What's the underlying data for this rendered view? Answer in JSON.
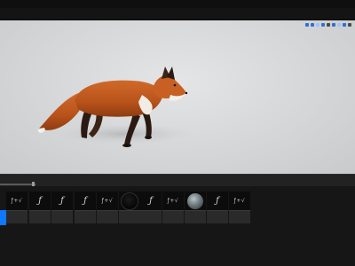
{
  "colors": {
    "accent": "#0e78ff",
    "viewport_bg": "#dcdddf",
    "panel_bg": "#161616"
  },
  "viewport": {
    "subject": "fox-model",
    "toolbar_icons": [
      "view-mode-icon",
      "lighting-icon",
      "show-icon",
      "camera-icon",
      "grid-icon",
      "snap-icon",
      "scale-icon",
      "angle-icon",
      "maximize-icon"
    ]
  },
  "content_browser": {
    "assets": [
      {
        "icon": "function-icon",
        "glyph": "",
        "label": ""
      },
      {
        "icon": "function-icon",
        "glyph": "ƒ",
        "label": ""
      },
      {
        "icon": "function-icon",
        "glyph": "ƒ",
        "label": ""
      },
      {
        "icon": "function-icon",
        "glyph": "ƒ",
        "label": ""
      },
      {
        "icon": "function-icon",
        "glyph": "ƒ",
        "label": ""
      },
      {
        "icon": "function-icon",
        "glyph": "ƒ",
        "label": ""
      },
      {
        "icon": "material-sphere-icon",
        "glyph": "",
        "label": ""
      },
      {
        "icon": "function-icon",
        "glyph": "ƒ",
        "label": ""
      },
      {
        "icon": "function-icon",
        "glyph": "ƒ",
        "label": ""
      },
      {
        "icon": "material-sphere-icon",
        "glyph": "",
        "label": ""
      },
      {
        "icon": "function-icon",
        "glyph": "ƒ",
        "label": ""
      },
      {
        "icon": "function-icon",
        "glyph": "ƒ",
        "label": ""
      }
    ]
  }
}
